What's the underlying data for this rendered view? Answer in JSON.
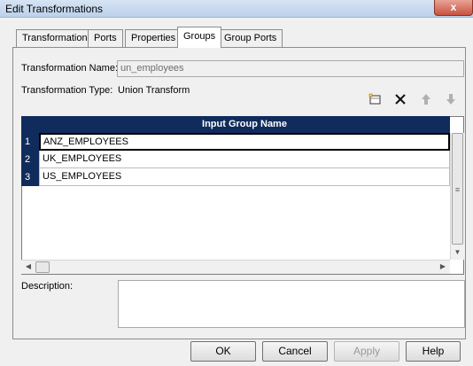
{
  "window": {
    "title": "Edit Transformations",
    "close_glyph": "x"
  },
  "tabs": [
    {
      "label": "Transformation"
    },
    {
      "label": "Ports"
    },
    {
      "label": "Properties"
    },
    {
      "label": "Groups"
    },
    {
      "label": "Group Ports"
    }
  ],
  "active_tab": "Groups",
  "form": {
    "name_label": "Transformation Name:",
    "name_value": "un_employees",
    "type_label": "Transformation Type:",
    "type_value": "Union Transform",
    "description_label": "Description:",
    "description_value": ""
  },
  "toolbar": {
    "icons": [
      "new-row-icon",
      "delete-icon",
      "move-up-icon",
      "move-down-icon"
    ]
  },
  "grid": {
    "column_header": "Input Group Name",
    "rows": [
      {
        "num": "1",
        "value": "ANZ_EMPLOYEES"
      },
      {
        "num": "2",
        "value": "UK_EMPLOYEES"
      },
      {
        "num": "3",
        "value": "US_EMPLOYEES"
      }
    ],
    "selected_row": 1,
    "header_color": "#102c5c"
  },
  "buttons": {
    "ok": "OK",
    "cancel": "Cancel",
    "apply": "Apply",
    "help": "Help"
  }
}
